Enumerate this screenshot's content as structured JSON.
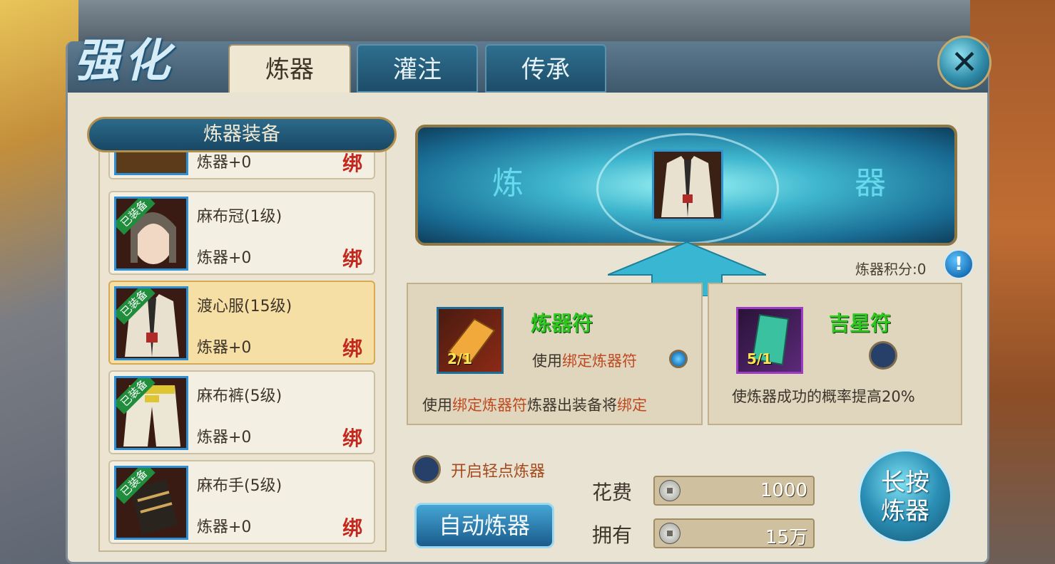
{
  "title": "强化",
  "tabs": [
    {
      "label": "炼器",
      "active": true
    },
    {
      "label": "灌注",
      "active": false
    },
    {
      "label": "传承",
      "active": false
    }
  ],
  "left_panel": {
    "header": "炼器装备",
    "partial_item": {
      "level": "炼器+0",
      "bind": "绑"
    },
    "items": [
      {
        "name": "麻布冠(1级)",
        "level": "炼器+0",
        "bind": "绑",
        "tag": "已装备",
        "selected": false
      },
      {
        "name": "渡心服(15级)",
        "level": "炼器+0",
        "bind": "绑",
        "tag": "已装备",
        "selected": true
      },
      {
        "name": "麻布裤(5级)",
        "level": "炼器+0",
        "bind": "绑",
        "tag": "已装备",
        "selected": false
      },
      {
        "name": "麻布手(5级)",
        "level": "炼器+0",
        "bind": "绑",
        "tag": "已装备",
        "selected": false
      }
    ]
  },
  "banner": {
    "left_glyph": "炼",
    "right_glyph": "器"
  },
  "score": {
    "label": "炼器积分:0"
  },
  "charm_left": {
    "title": "炼器符",
    "count": "2/1",
    "use_prefix": "使用",
    "use_highlight": "绑定炼器符",
    "note_prefix": "使用",
    "note_highlight1": "绑定炼器符",
    "note_middle": "炼器出装备将",
    "note_highlight2": "绑定",
    "selected": true
  },
  "charm_right": {
    "title": "吉星符",
    "count": "5/1",
    "note": "使炼器成功的概率提高20%",
    "selected": false
  },
  "toggle": {
    "label": "开启轻点炼器"
  },
  "auto_button": "自动炼器",
  "cost": {
    "label": "花费",
    "value": "1000"
  },
  "owned": {
    "label": "拥有",
    "value": "15万"
  },
  "long_press_button": {
    "line1": "长按",
    "line2": "炼器"
  },
  "colors": {
    "accent_blue": "#2f8ba8",
    "bind_red": "#c3281e",
    "charm_green": "#2fc61f",
    "highlight_orange": "#bd4a20"
  }
}
